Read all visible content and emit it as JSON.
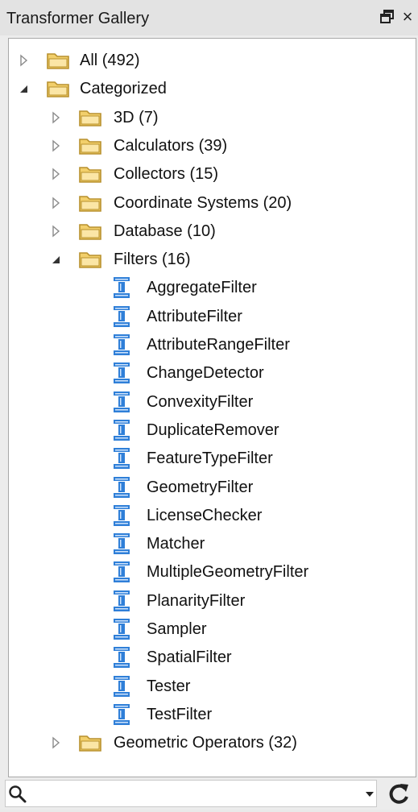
{
  "panel": {
    "title": "Transformer Gallery",
    "close_glyph": "×",
    "float_icon": "float-window-icon"
  },
  "tree": {
    "all": {
      "label": "All (492)",
      "expanded": false
    },
    "categorized": {
      "label": "Categorized",
      "expanded": true
    },
    "categories": [
      {
        "label": "3D (7)",
        "expanded": false
      },
      {
        "label": "Calculators (39)",
        "expanded": false
      },
      {
        "label": "Collectors (15)",
        "expanded": false
      },
      {
        "label": "Coordinate Systems (20)",
        "expanded": false
      },
      {
        "label": "Database (10)",
        "expanded": false
      },
      {
        "label": "Filters (16)",
        "expanded": true
      }
    ],
    "filters": [
      "AggregateFilter",
      "AttributeFilter",
      "AttributeRangeFilter",
      "ChangeDetector",
      "ConvexityFilter",
      "DuplicateRemover",
      "FeatureTypeFilter",
      "GeometryFilter",
      "LicenseChecker",
      "Matcher",
      "MultipleGeometryFilter",
      "PlanarityFilter",
      "Sampler",
      "SpatialFilter",
      "Tester",
      "TestFilter"
    ],
    "after": [
      {
        "label": "Geometric Operators (32)",
        "expanded": false
      }
    ]
  },
  "search": {
    "value": "",
    "placeholder": "",
    "icons": [
      "search-icon",
      "dropdown-icon",
      "refresh-icon"
    ]
  },
  "colors": {
    "folder_fill": "#f2cf6b",
    "folder_stroke": "#b8912e",
    "transformer_blue": "#2f7fd8"
  }
}
